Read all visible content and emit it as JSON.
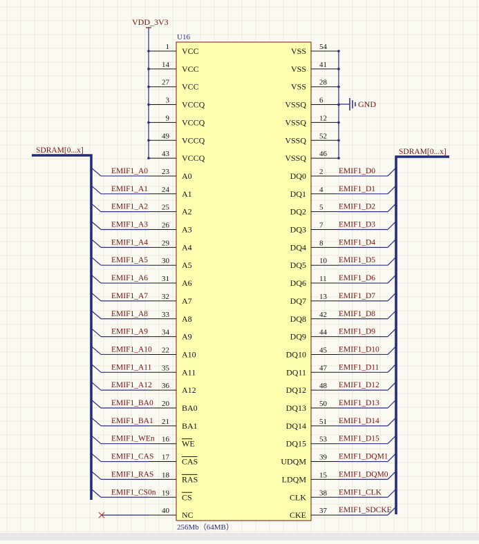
{
  "component": {
    "designator": "U16",
    "description": "256Mb（64MB）"
  },
  "power": {
    "vdd_label": "VDD_3V3",
    "gnd_label": "GND"
  },
  "bus_labels": {
    "left": "SDRAM[0...x]",
    "right": "SDRAM[0...x]"
  },
  "left_pins": [
    {
      "num": "1",
      "name": "VCC",
      "net": "",
      "kind": "power"
    },
    {
      "num": "14",
      "name": "VCC",
      "net": "",
      "kind": "power"
    },
    {
      "num": "27",
      "name": "VCC",
      "net": "",
      "kind": "power"
    },
    {
      "num": "3",
      "name": "VCCQ",
      "net": "",
      "kind": "power"
    },
    {
      "num": "9",
      "name": "VCCQ",
      "net": "",
      "kind": "power"
    },
    {
      "num": "49",
      "name": "VCCQ",
      "net": "",
      "kind": "power"
    },
    {
      "num": "43",
      "name": "VCCQ",
      "net": "",
      "kind": "power"
    },
    {
      "num": "23",
      "name": "A0",
      "net": "EMIF1_A0",
      "kind": "bus"
    },
    {
      "num": "24",
      "name": "A1",
      "net": "EMIF1_A1",
      "kind": "bus"
    },
    {
      "num": "25",
      "name": "A2",
      "net": "EMIF1_A2",
      "kind": "bus"
    },
    {
      "num": "26",
      "name": "A3",
      "net": "EMIF1_A3",
      "kind": "bus"
    },
    {
      "num": "29",
      "name": "A4",
      "net": "EMIF1_A4",
      "kind": "bus"
    },
    {
      "num": "30",
      "name": "A5",
      "net": "EMIF1_A5",
      "kind": "bus"
    },
    {
      "num": "31",
      "name": "A6",
      "net": "EMIF1_A6",
      "kind": "bus"
    },
    {
      "num": "32",
      "name": "A7",
      "net": "EMIF1_A7",
      "kind": "bus"
    },
    {
      "num": "33",
      "name": "A8",
      "net": "EMIF1_A8",
      "kind": "bus"
    },
    {
      "num": "34",
      "name": "A9",
      "net": "EMIF1_A9",
      "kind": "bus"
    },
    {
      "num": "22",
      "name": "A10",
      "net": "EMIF1_A10",
      "kind": "bus"
    },
    {
      "num": "35",
      "name": "A11",
      "net": "EMIF1_A11",
      "kind": "bus"
    },
    {
      "num": "36",
      "name": "A12",
      "net": "EMIF1_A12",
      "kind": "bus"
    },
    {
      "num": "20",
      "name": "BA0",
      "net": "EMIF1_BA0",
      "kind": "bus"
    },
    {
      "num": "21",
      "name": "BA1",
      "net": "EMIF1_BA1",
      "kind": "bus"
    },
    {
      "num": "16",
      "name": "WE",
      "net": "EMIF1_WEn",
      "kind": "bus",
      "overbar": true
    },
    {
      "num": "17",
      "name": "CAS",
      "net": "EMIF1_CAS",
      "kind": "bus",
      "overbar": true
    },
    {
      "num": "18",
      "name": "RAS",
      "net": "EMIF1_RAS",
      "kind": "bus",
      "overbar": true
    },
    {
      "num": "19",
      "name": "CS",
      "net": "EMIF1_CS0n",
      "kind": "bus",
      "overbar": true
    },
    {
      "num": "40",
      "name": "NC",
      "net": "",
      "kind": "nc"
    }
  ],
  "right_pins": [
    {
      "num": "54",
      "name": "VSS",
      "net": "",
      "kind": "ground"
    },
    {
      "num": "41",
      "name": "VSS",
      "net": "",
      "kind": "ground"
    },
    {
      "num": "28",
      "name": "VSS",
      "net": "",
      "kind": "ground"
    },
    {
      "num": "6",
      "name": "VSSQ",
      "net": "",
      "kind": "ground"
    },
    {
      "num": "12",
      "name": "VSSQ",
      "net": "",
      "kind": "ground"
    },
    {
      "num": "52",
      "name": "VSSQ",
      "net": "",
      "kind": "ground"
    },
    {
      "num": "46",
      "name": "VSSQ",
      "net": "",
      "kind": "ground"
    },
    {
      "num": "2",
      "name": "DQ0",
      "net": "EMIF1_D0",
      "kind": "bus"
    },
    {
      "num": "4",
      "name": "DQ1",
      "net": "EMIF1_D1",
      "kind": "bus"
    },
    {
      "num": "5",
      "name": "DQ2",
      "net": "EMIF1_D2",
      "kind": "bus"
    },
    {
      "num": "7",
      "name": "DQ3",
      "net": "EMIF1_D3",
      "kind": "bus"
    },
    {
      "num": "8",
      "name": "DQ4",
      "net": "EMIF1_D4",
      "kind": "bus"
    },
    {
      "num": "10",
      "name": "DQ5",
      "net": "EMIF1_D5",
      "kind": "bus"
    },
    {
      "num": "11",
      "name": "DQ6",
      "net": "EMIF1_D6",
      "kind": "bus"
    },
    {
      "num": "13",
      "name": "DQ7",
      "net": "EMIF1_D7",
      "kind": "bus"
    },
    {
      "num": "42",
      "name": "DQ8",
      "net": "EMIF1_D8",
      "kind": "bus"
    },
    {
      "num": "44",
      "name": "DQ9",
      "net": "EMIF1_D9",
      "kind": "bus"
    },
    {
      "num": "45",
      "name": "DQ10",
      "net": "EMIF1_D10",
      "kind": "bus"
    },
    {
      "num": "47",
      "name": "DQ11",
      "net": "EMIF1_D11",
      "kind": "bus"
    },
    {
      "num": "48",
      "name": "DQ12",
      "net": "EMIF1_D12",
      "kind": "bus"
    },
    {
      "num": "50",
      "name": "DQ13",
      "net": "EMIF1_D13",
      "kind": "bus"
    },
    {
      "num": "51",
      "name": "DQ14",
      "net": "EMIF1_D14",
      "kind": "bus"
    },
    {
      "num": "53",
      "name": "DQ15",
      "net": "EMIF1_D15",
      "kind": "bus"
    },
    {
      "num": "39",
      "name": "UDQM",
      "net": "EMIF1_DQM1",
      "kind": "bus"
    },
    {
      "num": "15",
      "name": "LDQM",
      "net": "EMIF1_DQM0",
      "kind": "bus"
    },
    {
      "num": "38",
      "name": "CLK",
      "net": "EMIF1_CLK",
      "kind": "bus"
    },
    {
      "num": "37",
      "name": "CKE",
      "net": "EMIF1_SDCKE",
      "kind": "bus"
    }
  ],
  "colors": {
    "body_fill": "#ffffb0",
    "body_stroke": "#7a1010",
    "wire": "#2a2a8a",
    "net_label": "#7a1010"
  }
}
